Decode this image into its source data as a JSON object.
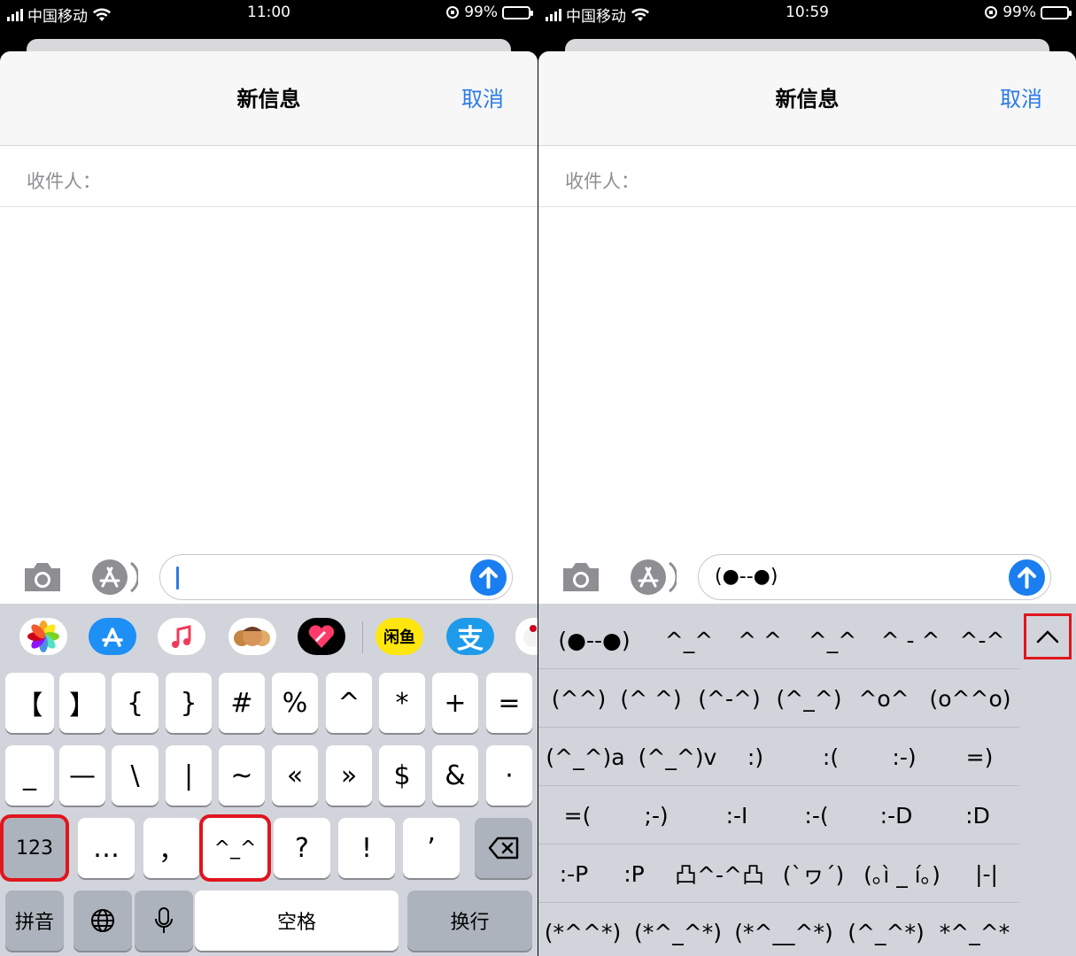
{
  "left": {
    "status": {
      "carrier": "中国移动",
      "time": "11:00",
      "battery": "99%"
    },
    "nav": {
      "title": "新信息",
      "cancel": "取消"
    },
    "to_label": "收件人：",
    "message_text": "",
    "app_strip": [
      "photos",
      "app-store",
      "music",
      "memoji",
      "digital-touch",
      "闲鱼",
      "支",
      "game"
    ],
    "keyboard": {
      "row1": [
        "【",
        "】",
        "{",
        "}",
        "#",
        "%",
        "^",
        "*",
        "+",
        "="
      ],
      "row2": [
        "_",
        "—",
        "\\",
        "|",
        "~",
        "«",
        "»",
        "$",
        "&",
        "·"
      ],
      "row3": [
        "123",
        "…",
        "，",
        "^_^",
        "?",
        "!",
        "’"
      ],
      "row4": {
        "pinyin": "拼音",
        "space": "空格",
        "return": "换行"
      }
    }
  },
  "right": {
    "status": {
      "carrier": "中国移动",
      "time": "10:59",
      "battery": "99%"
    },
    "nav": {
      "title": "新信息",
      "cancel": "取消"
    },
    "to_label": "收件人：",
    "message_text": "(●--●)",
    "emoticons": [
      [
        "(●--●)",
        "^_^",
        "^ ^",
        "^_^",
        "^ - ^",
        "^-^"
      ],
      [
        "(^^)",
        "(^ ^)",
        "(^-^)",
        "(^_^)",
        "^o^",
        "(o^^o)"
      ],
      [
        "(^_^)a",
        "(^_^)v",
        ":)",
        ":(",
        ":-)",
        "=)"
      ],
      [
        "=(",
        ";-)",
        ":-I",
        ":-(",
        ":-D",
        ":D"
      ],
      [
        ":-P",
        ":P",
        "凸^-^凸",
        "(`ヮ´)",
        "(｡ì _ í｡)",
        "|-|"
      ],
      [
        "(*^^*)",
        "(*^_^*)",
        "(*^__^*)",
        "(^_^*)",
        "*^_^*"
      ]
    ]
  }
}
